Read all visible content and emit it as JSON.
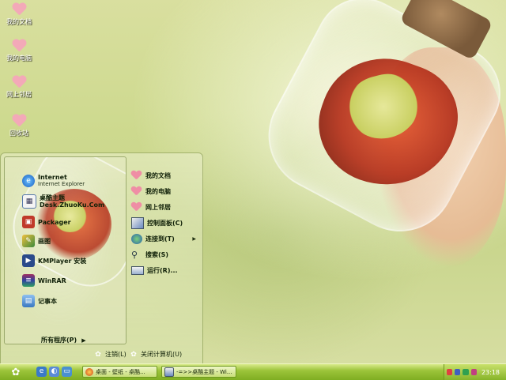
{
  "desktop": {
    "icons": [
      {
        "label": "我的文档"
      },
      {
        "label": "我的电脑"
      },
      {
        "label": "网上邻居"
      },
      {
        "label": "回收站"
      }
    ]
  },
  "start_menu": {
    "pinned": [
      {
        "title": "Internet",
        "subtitle": "Internet Explorer",
        "icon": "ie-icon"
      },
      {
        "title": "桌酷主题Desk.ZhuoKu.Com",
        "icon": "theme-app-icon"
      }
    ],
    "recent": [
      {
        "title": "Packager",
        "icon": "packager-icon"
      },
      {
        "title": "画图",
        "icon": "paint-icon"
      },
      {
        "title": "KMPlayer 安装",
        "icon": "kmplayer-icon"
      },
      {
        "title": "WinRAR",
        "icon": "winrar-icon"
      },
      {
        "title": "记事本",
        "icon": "notepad-icon"
      }
    ],
    "all_programs": "所有程序(P)",
    "places": [
      {
        "label": "我的文档",
        "icon": "heart-icon"
      },
      {
        "label": "我的电脑",
        "icon": "heart-icon"
      },
      {
        "label": "网上邻居",
        "icon": "heart-icon"
      },
      {
        "label": "控制面板(C)",
        "icon": "control-panel-icon"
      },
      {
        "label": "连接到(T)",
        "icon": "connect-icon",
        "submenu": true
      },
      {
        "label": "搜索(S)",
        "icon": "search-icon"
      },
      {
        "label": "运行(R)...",
        "icon": "run-icon"
      }
    ],
    "logoff": "注销(L)",
    "shutdown": "关闭计算机(U)"
  },
  "taskbar": {
    "tasks": [
      {
        "label": "桌面 - 壁纸 - 桌酷..."
      },
      {
        "label": "-=>>桌酷主题 - Wi..."
      }
    ],
    "clock": "23:18"
  },
  "colors": {
    "taskbar": "#8fbb2e",
    "accent_pink": "#ef8ea5"
  }
}
